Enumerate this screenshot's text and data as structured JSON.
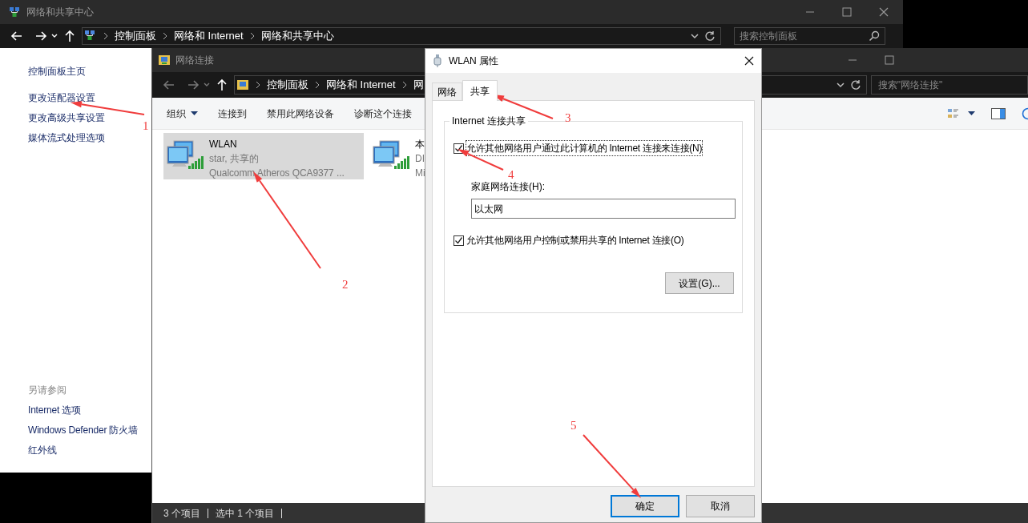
{
  "back_window": {
    "title": "网络和共享中心",
    "breadcrumb": [
      "控制面板",
      "网络和 Internet",
      "网络和共享中心"
    ],
    "search": {
      "placeholder": "搜索控制面板"
    },
    "sidebar": {
      "links": [
        "控制面板主页",
        "更改适配器设置",
        "更改高级共享设置",
        "媒体流式处理选项"
      ],
      "see_also_heading": "另请参阅",
      "see_also": [
        "Internet 选项",
        "Windows Defender 防火墙",
        "红外线"
      ]
    }
  },
  "connections_window": {
    "title": "网络连接",
    "breadcrumb": [
      "控制面板",
      "网络和 Internet",
      "网"
    ],
    "search": {
      "placeholder": "搜索\"网络连接\""
    },
    "toolbar": [
      {
        "label": "组织",
        "dropdown": true
      },
      {
        "label": "连接到",
        "dropdown": false
      },
      {
        "label": "禁用此网络设备",
        "dropdown": false
      },
      {
        "label": "诊断这个连接",
        "dropdown": false
      }
    ],
    "items": [
      {
        "name": "WLAN",
        "status": "star, 共享的",
        "device": "Qualcomm Atheros QCA9377 ...",
        "selected": true
      },
      {
        "name": "本",
        "status": "DI",
        "device": "Mi",
        "selected": false
      }
    ],
    "status_bar": [
      "3 个项目",
      "选中 1 个项目"
    ]
  },
  "dialog": {
    "title": "WLAN 属性",
    "tabs": [
      {
        "label": "网络",
        "selected": false
      },
      {
        "label": "共享",
        "selected": true
      }
    ],
    "group_title": "Internet 连接共享",
    "options": [
      {
        "label": "允许其他网络用户通过此计算机的 Internet 连接来连接(N)",
        "checked": true,
        "focused": true
      },
      {
        "label": "允许其他网络用户控制或禁用共享的 Internet 连接(O)",
        "checked": true,
        "focused": false
      }
    ],
    "home_label": "家庭网络连接(H):",
    "home_value": "以太网",
    "settings_button": "设置(G)...",
    "buttons": [
      {
        "label": "确定",
        "default": true
      },
      {
        "label": "取消",
        "default": false
      }
    ]
  },
  "annotations": [
    "1",
    "2",
    "3",
    "4",
    "5"
  ]
}
